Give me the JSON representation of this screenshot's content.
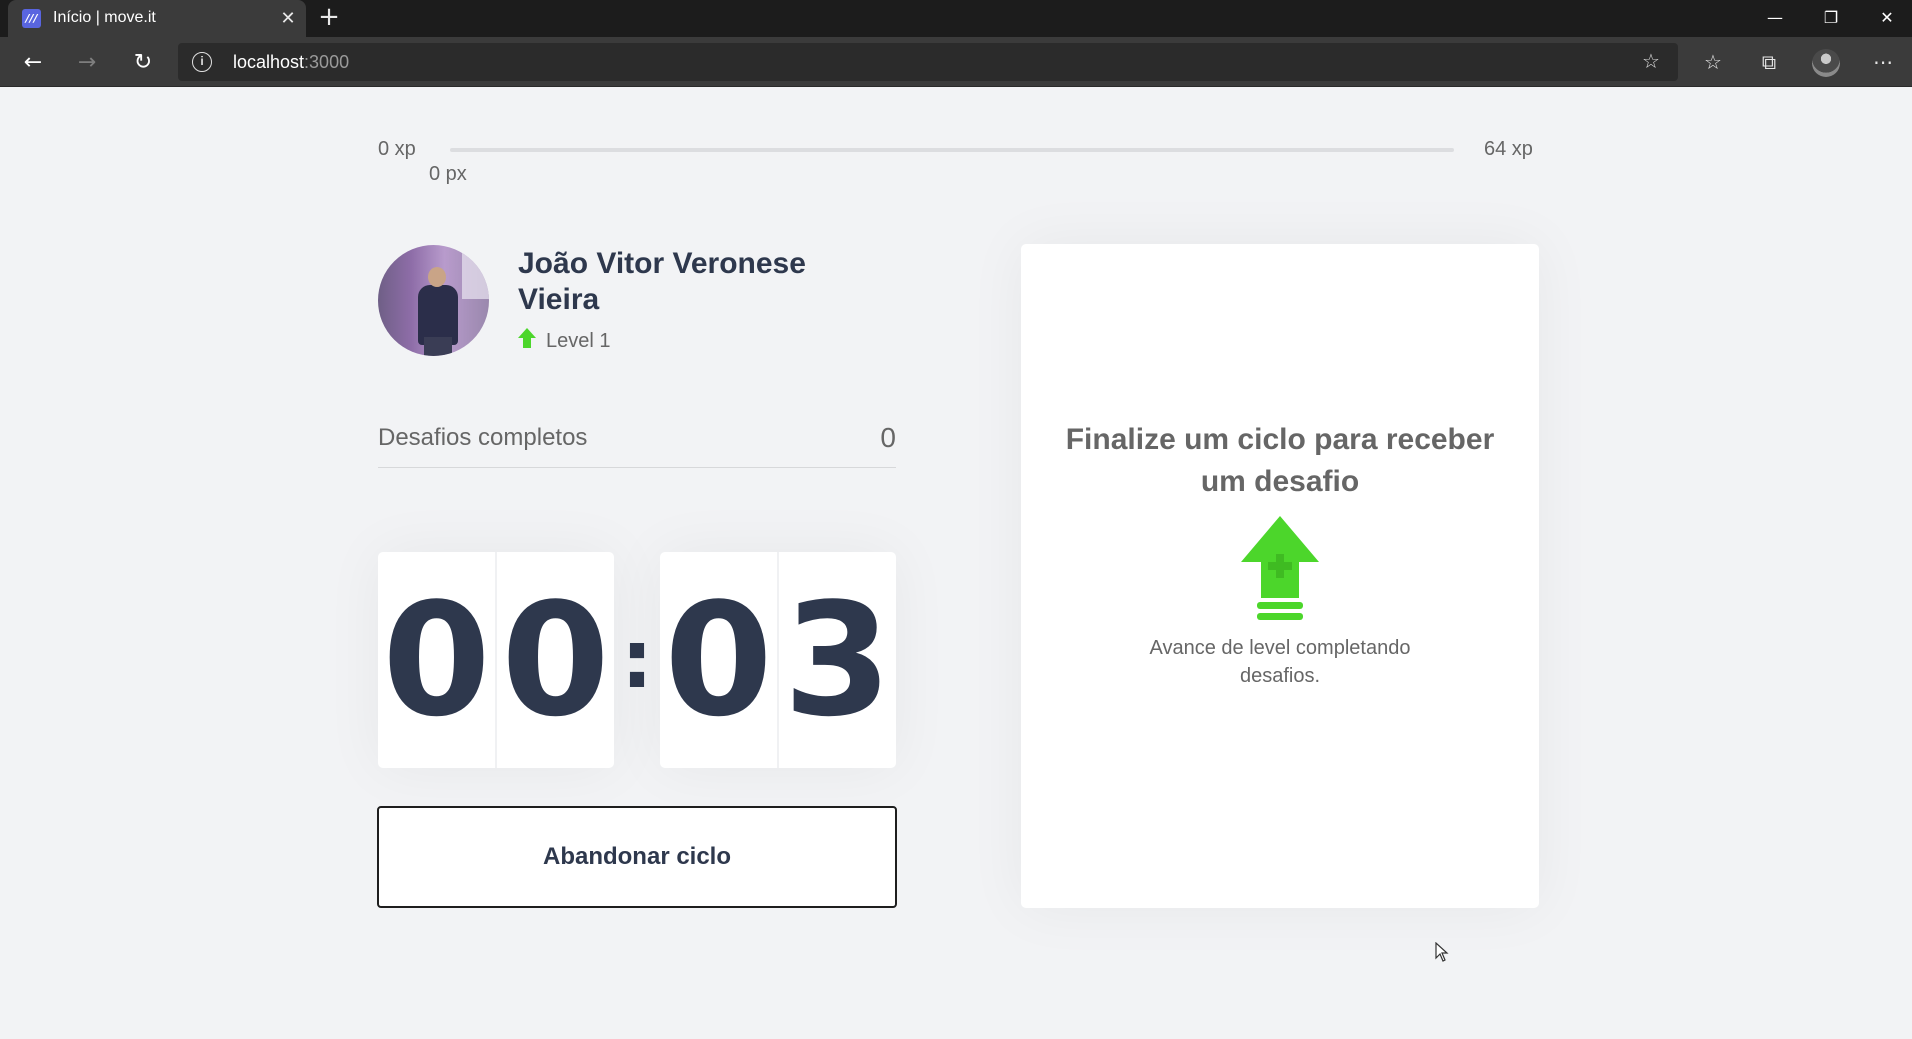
{
  "browser": {
    "tab_title": "Início | move.it",
    "favicon_glyph": "///",
    "close_glyph": "✕",
    "new_tab_glyph": "+",
    "window_controls": {
      "minimize": "—",
      "restore": "❐",
      "close": "✕"
    },
    "nav": {
      "back": "←",
      "forward": "→",
      "reload": "↻"
    },
    "address": {
      "info_glyph": "i",
      "host": "localhost",
      "port": ":3000"
    },
    "toolbar_icons": {
      "add_favorite": "☆",
      "favorites": "☆",
      "collections": "⧉",
      "more": "⋯"
    }
  },
  "experience": {
    "min_label": "0 xp",
    "max_label": "64 xp",
    "current_label": "0 px",
    "progress": 0
  },
  "profile": {
    "name": "João Vitor Veronese Vieira",
    "level_label": "Level 1"
  },
  "challenges": {
    "label": "Desafios completos",
    "count": "0"
  },
  "countdown": {
    "minute_left": "0",
    "minute_right": "0",
    "separator": ":",
    "second_left": "0",
    "second_right": "3"
  },
  "actions": {
    "abandon_label": "Abandonar ciclo"
  },
  "challenge_box": {
    "title": "Finalize um ciclo para receber um desafio",
    "description": "Avance de level completando desafios."
  },
  "colors": {
    "accent_green": "#4cd62b",
    "title_dark": "#2e384d",
    "text_gray": "#666666",
    "page_bg": "#f2f3f5"
  }
}
